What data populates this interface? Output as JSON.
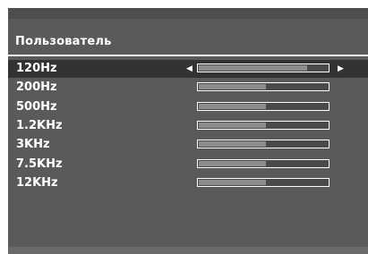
{
  "title": "Пользователь",
  "bands": [
    {
      "label": "120Hz",
      "level": 0.84,
      "selected": true
    },
    {
      "label": "200Hz",
      "level": 0.52,
      "selected": false
    },
    {
      "label": "500Hz",
      "level": 0.52,
      "selected": false
    },
    {
      "label": "1.2KHz",
      "level": 0.52,
      "selected": false
    },
    {
      "label": "3KHz",
      "level": 0.52,
      "selected": false
    },
    {
      "label": "7.5KHz",
      "level": 0.52,
      "selected": false
    },
    {
      "label": "12KHz",
      "level": 0.52,
      "selected": false
    }
  ],
  "icons": {
    "left": "left-arrow-icon",
    "right": "right-arrow-icon"
  }
}
